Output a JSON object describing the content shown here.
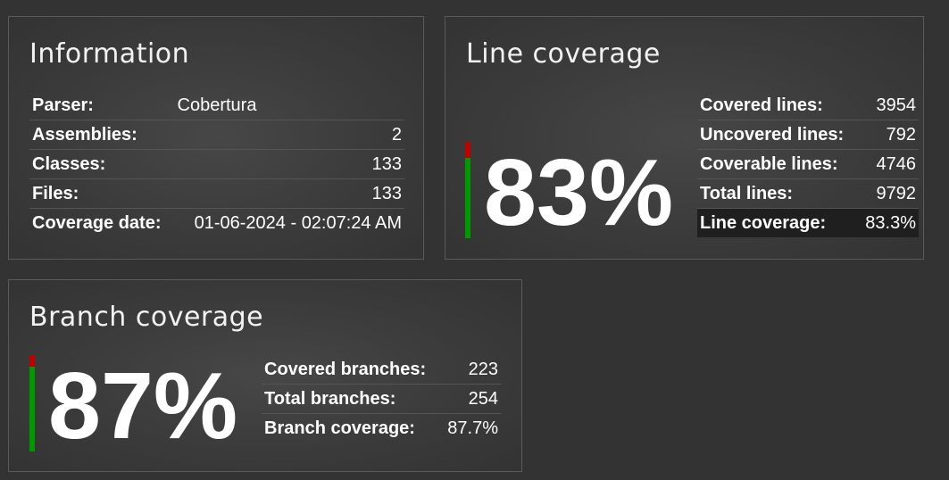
{
  "information": {
    "title": "Information",
    "rows": [
      {
        "label": "Parser:",
        "value": "Cobertura"
      },
      {
        "label": "Assemblies:",
        "value": "2"
      },
      {
        "label": "Classes:",
        "value": "133"
      },
      {
        "label": "Files:",
        "value": "133"
      },
      {
        "label": "Coverage date:",
        "value": "01-06-2024 - 02:07:24 AM"
      }
    ]
  },
  "line_coverage": {
    "title": "Line coverage",
    "percent_text": "83%",
    "percent": 83.3,
    "rows": [
      {
        "label": "Covered lines:",
        "value": "3954"
      },
      {
        "label": "Uncovered lines:",
        "value": "792"
      },
      {
        "label": "Coverable lines:",
        "value": "4746"
      },
      {
        "label": "Total lines:",
        "value": "9792"
      },
      {
        "label": "Line coverage:",
        "value": "83.3%"
      }
    ]
  },
  "branch_coverage": {
    "title": "Branch coverage",
    "percent_text": "87%",
    "percent": 87.7,
    "rows": [
      {
        "label": "Covered branches:",
        "value": "223"
      },
      {
        "label": "Total branches:",
        "value": "254"
      },
      {
        "label": "Branch coverage:",
        "value": "87.7%"
      }
    ]
  },
  "colors": {
    "covered": "#009900",
    "uncovered": "#c00000",
    "background": "#333333"
  }
}
